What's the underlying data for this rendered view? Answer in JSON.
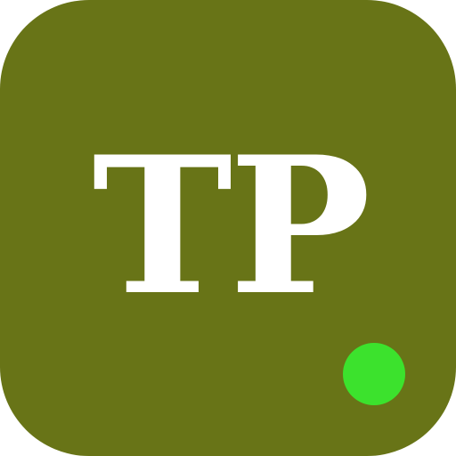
{
  "app_icon": {
    "monogram": "TP",
    "background_color": "#687417",
    "text_color": "#ffffff",
    "status_indicator": {
      "color": "#3ce22d",
      "state": "online"
    }
  }
}
